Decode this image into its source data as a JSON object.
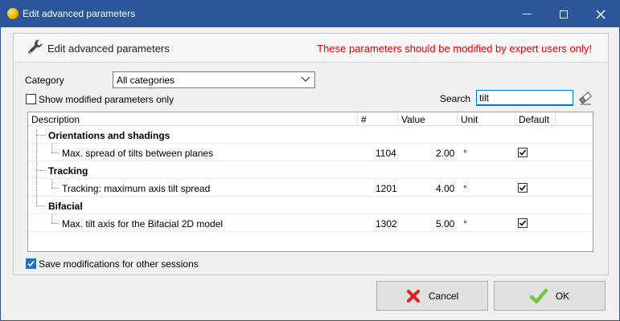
{
  "window": {
    "title": "Edit advanced parameters"
  },
  "header": {
    "title": "Edit advanced parameters",
    "warning": "These parameters should be modified by expert users only!",
    "warning_color": "#e00000"
  },
  "filters": {
    "category_label": "Category",
    "category_value": "All categories",
    "show_modified_label": "Show modified parameters only",
    "show_modified_checked": false,
    "search_label": "Search",
    "search_value": "tilt"
  },
  "table": {
    "columns": [
      "Description",
      "#",
      "Value",
      "Unit",
      "Default"
    ],
    "groups": [
      {
        "label": "Orientations and shadings",
        "items": [
          {
            "description": "Max. spread of tilts between planes",
            "id": "1104",
            "value": "2.00",
            "unit": "°",
            "default": true
          }
        ]
      },
      {
        "label": "Tracking",
        "items": [
          {
            "description": "Tracking: maximum axis tilt spread",
            "id": "1201",
            "value": "4.00",
            "unit": "°",
            "default": true
          }
        ]
      },
      {
        "label": "Bifacial",
        "items": [
          {
            "description": "Max. tilt axis for the Bifacial 2D model",
            "id": "1302",
            "value": "5.00",
            "unit": "°",
            "default": true
          }
        ]
      }
    ]
  },
  "save_option": {
    "label": "Save modifications for other sessions",
    "checked": true
  },
  "buttons": {
    "cancel": "Cancel",
    "ok": "OK"
  },
  "colors": {
    "titlebar": "#2b579a",
    "accent": "#1f70c1",
    "cancel_icon": "#e0201c",
    "ok_icon": "#7cc242"
  },
  "icons": [
    "app-icon",
    "minimize-icon",
    "maximize-icon",
    "close-icon",
    "wrench-icon",
    "chevron-down-icon",
    "eraser-icon",
    "checkmark-icon",
    "cancel-x-icon",
    "ok-check-icon"
  ]
}
